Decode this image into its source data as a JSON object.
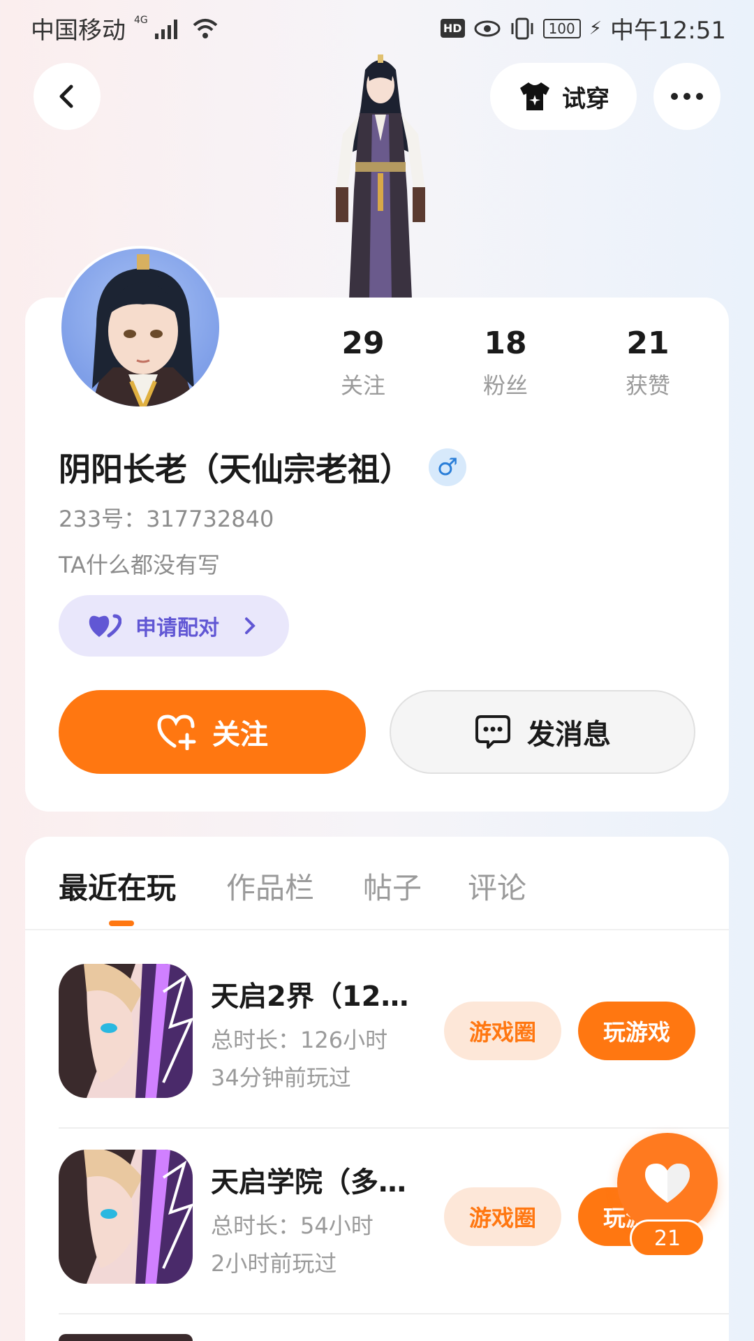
{
  "status_bar": {
    "carrier": "中国移动",
    "network": "4G",
    "hd": "HD",
    "battery": "100",
    "time": "中午12:51"
  },
  "top_bar": {
    "try_on_label": "试穿"
  },
  "profile": {
    "nickname": "阴阳长老（天仙宗老祖）",
    "gender": "male",
    "gender_symbol": "♂",
    "uid": "233号：317732840",
    "bio": "TA什么都没有写",
    "pair_label": "申请配对",
    "stats": [
      {
        "value": "29",
        "label": "关注"
      },
      {
        "value": "18",
        "label": "粉丝"
      },
      {
        "value": "21",
        "label": "获赞"
      }
    ],
    "follow_label": "关注",
    "message_label": "发消息"
  },
  "tabs": [
    {
      "label": "最近在玩",
      "active": true
    },
    {
      "label": "作品栏",
      "active": false
    },
    {
      "label": "帖子",
      "active": false
    },
    {
      "label": "评论",
      "active": false
    }
  ],
  "games": [
    {
      "title": "天启2界（120…",
      "duration": "总时长：126小时",
      "last_played": "34分钟前玩过",
      "circle_label": "游戏圈",
      "play_label": "玩游戏"
    },
    {
      "title": "天启学院（多…",
      "duration": "总时长：54小时",
      "last_played": "2小时前玩过",
      "circle_label": "游戏圈",
      "play_label": "玩游戏"
    }
  ],
  "like_fab": {
    "count": "21"
  },
  "colors": {
    "accent": "#ff7711",
    "pair_bg": "#e9e7fb",
    "pair_text": "#6157d4",
    "gender_bg": "#d7e9fb"
  }
}
